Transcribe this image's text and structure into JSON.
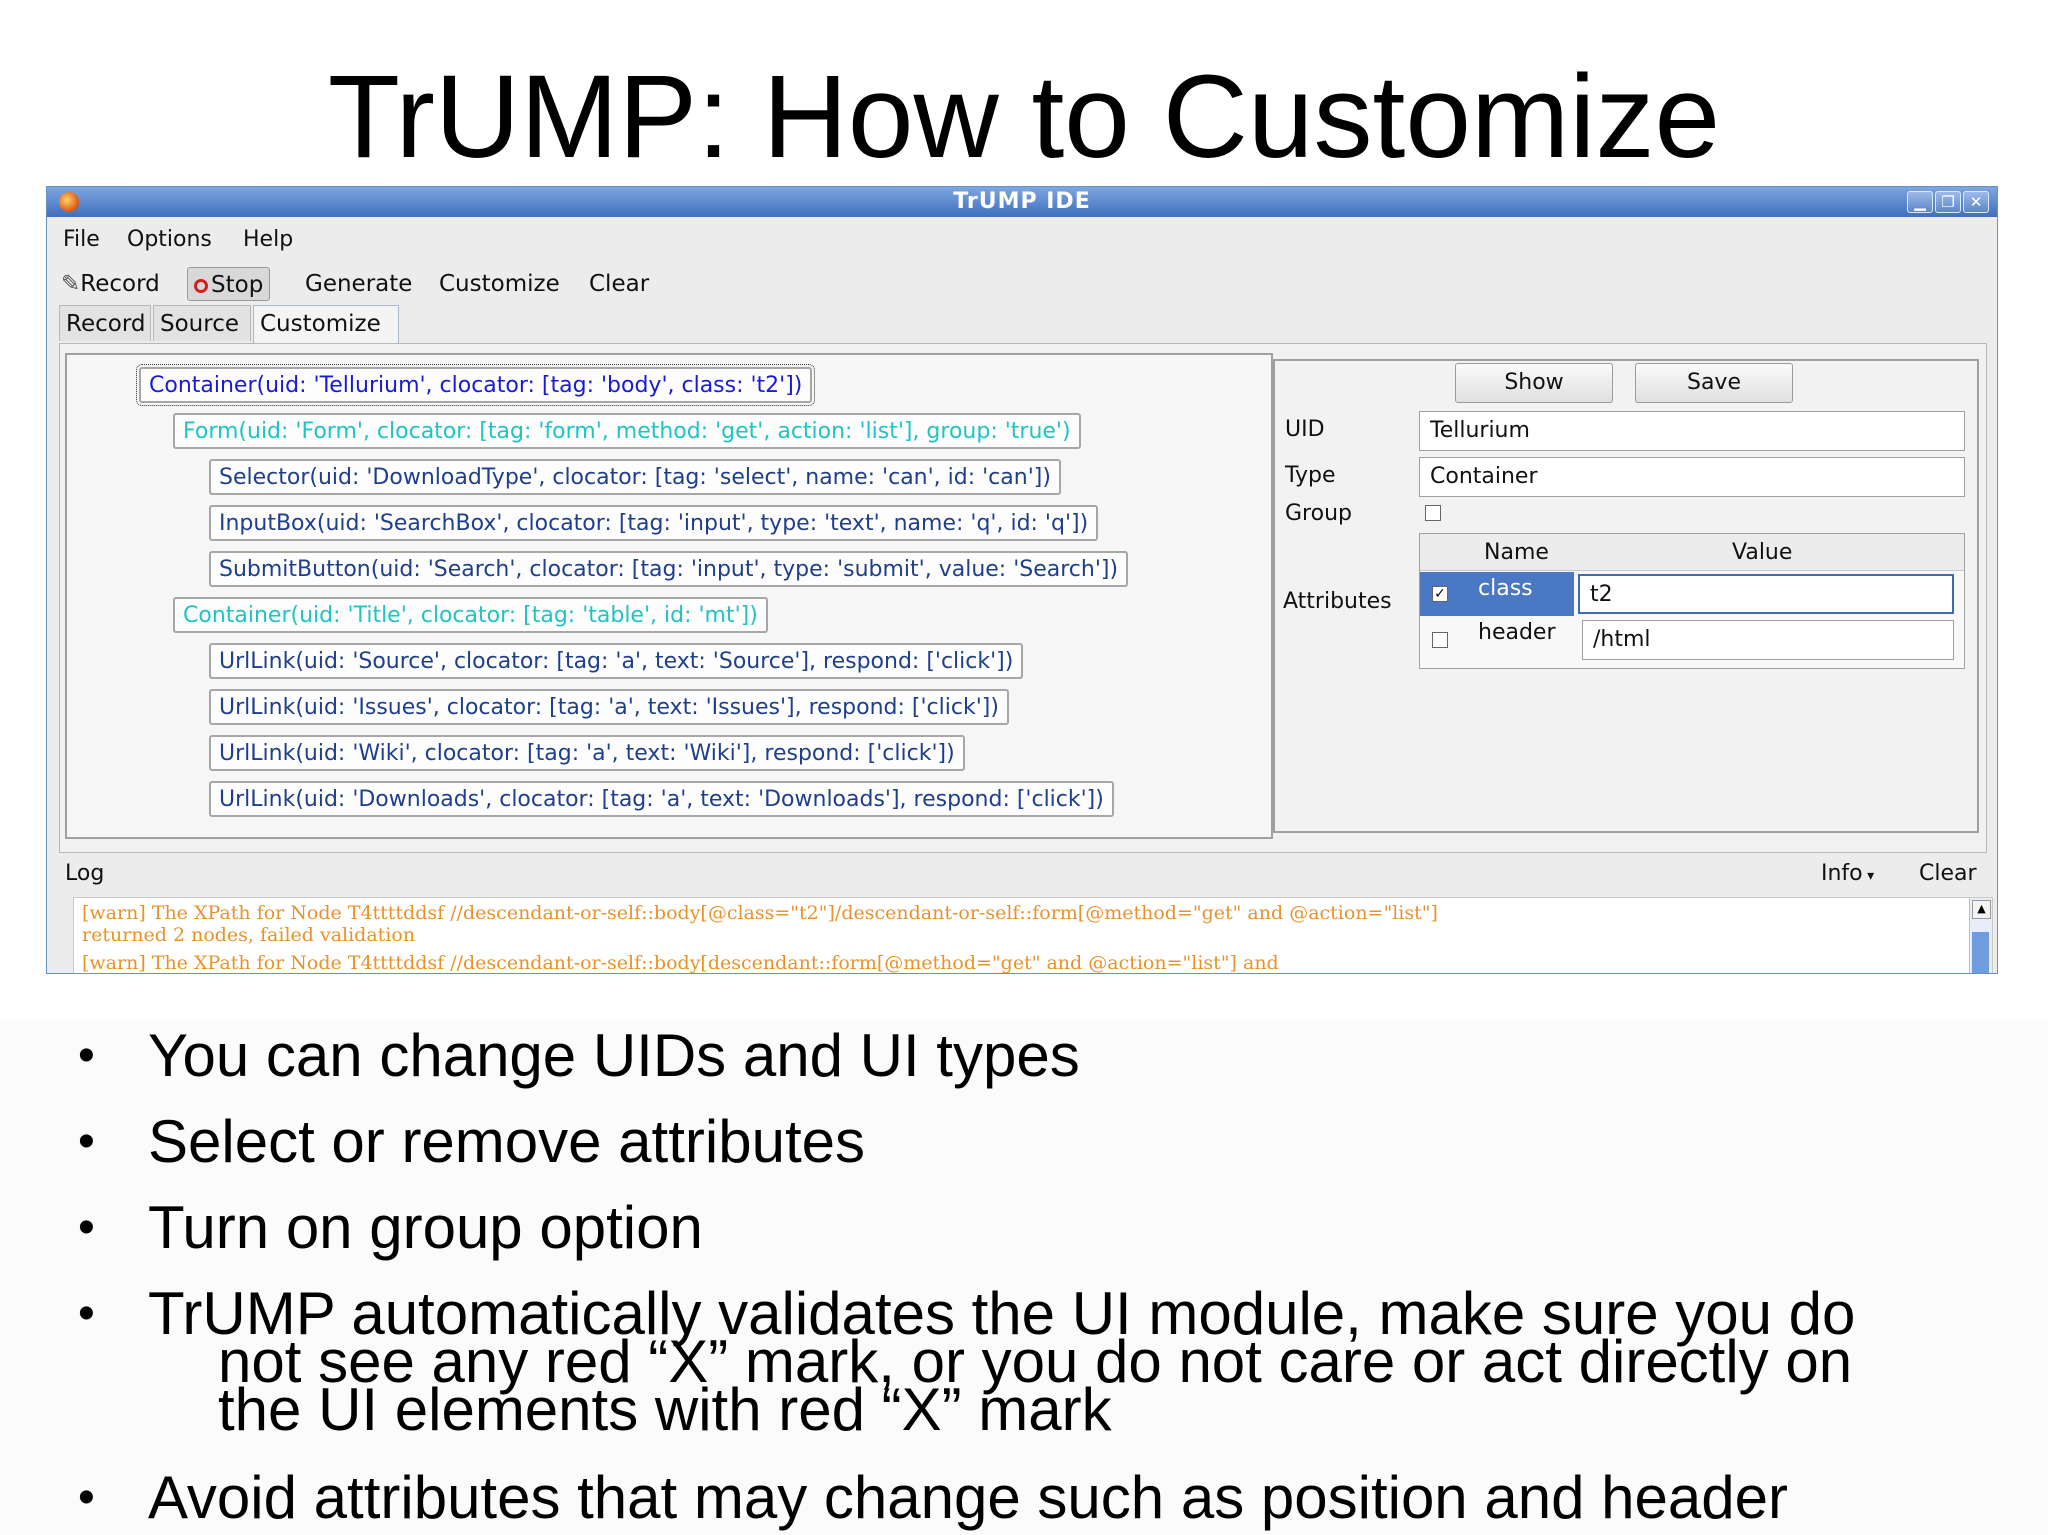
{
  "slide": {
    "title": "TrUMP: How to Customize",
    "bullets": [
      "You can change UIDs and UI types",
      "Select or remove attributes",
      "Turn on group option",
      "TrUMP automatically validates the UI module, make sure you do",
      "Avoid attributes that may change such as position and header"
    ],
    "bullet4_cont1": "not see any red “X” mark, or you do not care or act directly on",
    "bullet4_cont2": "the UI elements with red “X” mark"
  },
  "window": {
    "title": "TrUMP IDE",
    "controls": {
      "minimize": "▁",
      "maximize": "❐",
      "close": "✕"
    },
    "menu": [
      "File",
      "Options",
      "Help"
    ],
    "toolbar": {
      "record": "Record",
      "stop": "Stop",
      "generate": "Generate",
      "customize": "Customize",
      "clear": "Clear"
    },
    "tabs": [
      "Record",
      "Source",
      "Customize"
    ],
    "active_tab": "Customize"
  },
  "tree": [
    {
      "text": "Container(uid: 'Tellurium', clocator: [tag: 'body', class: 't2'])",
      "color": "#1a1ad6",
      "level": 0
    },
    {
      "text": "Form(uid: 'Form', clocator: [tag: 'form', method: 'get', action: 'list'], group: 'true')",
      "color": "#20c4c4",
      "level": 1
    },
    {
      "text": "Selector(uid: 'DownloadType', clocator: [tag: 'select', name: 'can', id: 'can'])",
      "color": "#1f3f8a",
      "level": 2
    },
    {
      "text": "InputBox(uid: 'SearchBox', clocator: [tag: 'input', type: 'text', name: 'q', id: 'q'])",
      "color": "#1f3f8a",
      "level": 2
    },
    {
      "text": "SubmitButton(uid: 'Search', clocator: [tag: 'input', type: 'submit', value: 'Search'])",
      "color": "#1f3f8a",
      "level": 2
    },
    {
      "text": "Container(uid: 'Title', clocator: [tag: 'table', id: 'mt'])",
      "color": "#20c4c4",
      "level": 1
    },
    {
      "text": "UrlLink(uid: 'Source', clocator: [tag: 'a', text: 'Source'], respond: ['click'])",
      "color": "#1f3f8a",
      "level": 2
    },
    {
      "text": "UrlLink(uid: 'Issues', clocator: [tag: 'a', text: 'Issues'], respond: ['click'])",
      "color": "#1f3f8a",
      "level": 2
    },
    {
      "text": "UrlLink(uid: 'Wiki', clocator: [tag: 'a', text: 'Wiki'], respond: ['click'])",
      "color": "#1f3f8a",
      "level": 2
    },
    {
      "text": "UrlLink(uid: 'Downloads', clocator: [tag: 'a', text: 'Downloads'], respond: ['click'])",
      "color": "#1f3f8a",
      "level": 2
    }
  ],
  "props": {
    "show_label": "Show",
    "save_label": "Save",
    "uid_label": "UID",
    "uid_value": "Tellurium",
    "type_label": "Type",
    "type_value": "Container",
    "group_label": "Group",
    "group_checked": false,
    "attributes_label": "Attributes",
    "attr_headers": {
      "name": "Name",
      "value": "Value"
    },
    "attrs": [
      {
        "name": "class",
        "value": "t2",
        "checked": true
      },
      {
        "name": "header",
        "value": "/html",
        "checked": false
      }
    ]
  },
  "log": {
    "label": "Log",
    "level": "Info",
    "clear_label": "Clear",
    "lines": [
      "[warn] The XPath for Node T4ttttddsf //descendant-or-self::body[@class=\"t2\"]/descendant-or-self::form[@method=\"get\" and @action=\"list\"]",
      "returned 2 nodes, failed validation",
      "[warn] The XPath for Node T4ttttddsf //descendant-or-self::body[descendant::form[@method=\"get\" and @action=\"list\"] and"
    ]
  }
}
